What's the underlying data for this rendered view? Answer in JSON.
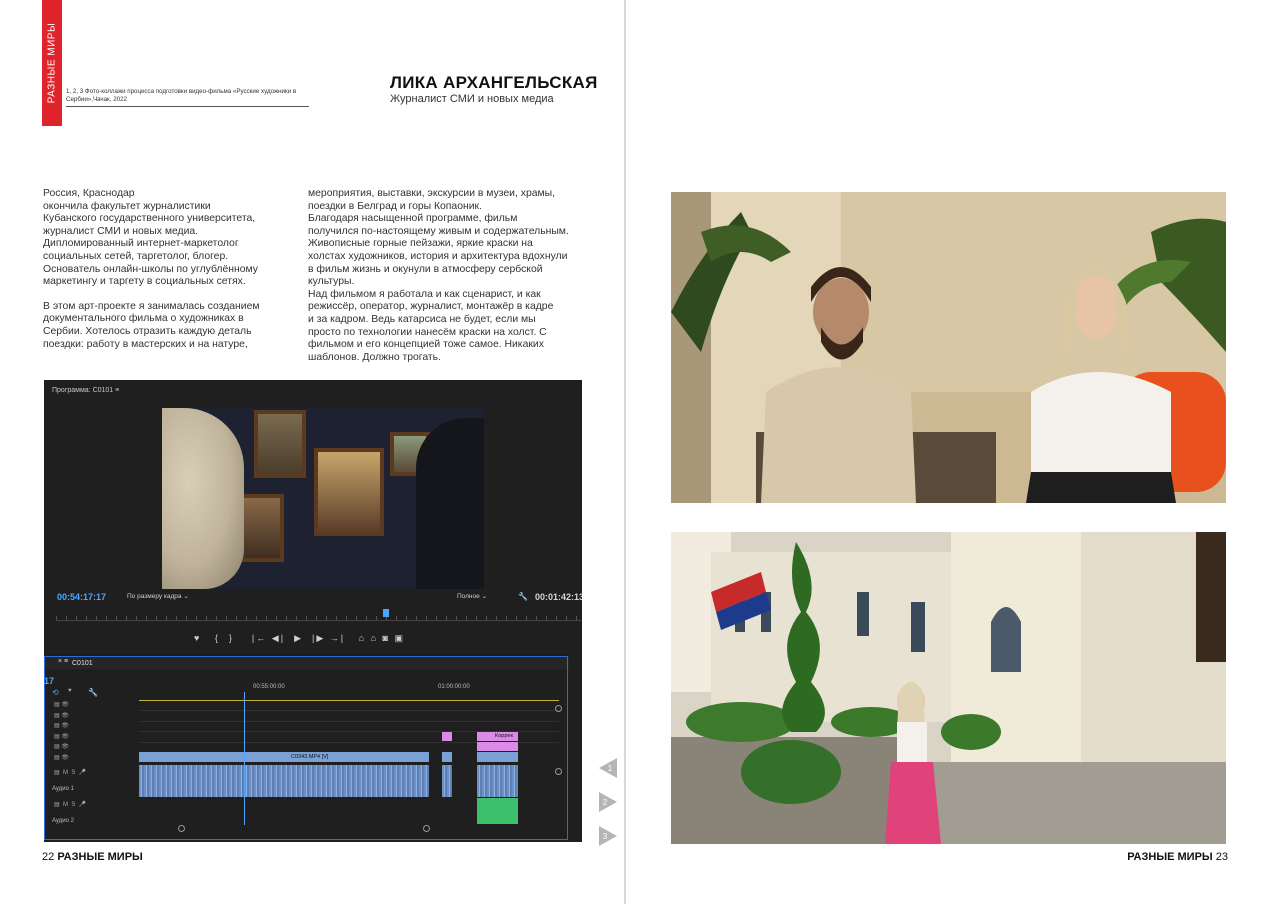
{
  "left_page": {
    "side_tab": "РАЗНЫЕ МИРЫ",
    "caption": "1, 2, 3 Фото-коллажи процесса подготовки видео-фильма «Русские художники в Сербии»,Чачак, 2022",
    "author": {
      "name": "ЛИКА АРХАНГЕЛЬСКАЯ",
      "role": "Журналист СМИ и новых медиа"
    },
    "column1": [
      "Россия, Краснодар",
      "окончила факультет журналистики",
      "Кубанского государственного университета,",
      "журналист СМИ и новых медиа.",
      "Дипломированный интернет-маркетолог",
      "социальных сетей, таргетолог, блогер.",
      "Основатель онлайн-школы по углублённому",
      "маркетингу и таргету в социальных сетях.",
      "",
      "В этом арт-проекте я занималась созданием",
      "документального фильма о художниках в",
      "Сербии. Хотелось отразить каждую деталь",
      "поездки: работу в мастерских и на натуре,"
    ],
    "column2": [
      "мероприятия, выставки, экскурсии в музеи, храмы,",
      " поездки в Белград и горы Копаоник.",
      "Благодаря насыщенной программе, фильм",
      "получился по-настоящему живым и содержательным.",
      "Живописные горные пейзажи, яркие краски на",
      "холстах художников, история и архитектура  вдохнули",
      "в фильм жизнь и окунули в атмосферу сербской",
      "культуры.",
      "Над фильмом я работала и как сценарист, и как",
      "режиссёр, оператор, журналист, монтажёр в кадре",
      "и за кадром. Ведь катарсиса не будет, если мы",
      "просто по технологии нанесём краски на холст. С",
      "фильмом и его концепцией тоже самое. Никаких",
      "шаблонов. Должно трогать."
    ],
    "folio": {
      "number": "22",
      "title": "РАЗНЫЕ МИРЫ"
    },
    "markers": [
      "1",
      "2",
      "3"
    ]
  },
  "editor": {
    "program_label": "Программа: C0101",
    "timecode_current": "00:54:17:17",
    "timecode_end": "00:01:42:13",
    "fit_label": "По размеру кадра",
    "quality_label": "Полное",
    "sequence_tab": "C0101",
    "side_frame_number": "17",
    "ruler_marks": [
      "00:55:00:00",
      "01:00:00:00"
    ],
    "clip_video_label": "C0343.MP4 [V]",
    "clip_fx_label": "Коррек",
    "tracks": [
      {
        "name": "Аудио 1"
      },
      {
        "name": "Аудио 2"
      }
    ],
    "track_buttons": [
      "M",
      "S"
    ]
  },
  "right_page": {
    "folio": {
      "title": "РАЗНЫЕ МИРЫ",
      "number": "23"
    }
  },
  "colors": {
    "accent_red": "#e0242b",
    "editor_blue": "#4ea6ff",
    "marker_gray": "#b5b5b5"
  }
}
